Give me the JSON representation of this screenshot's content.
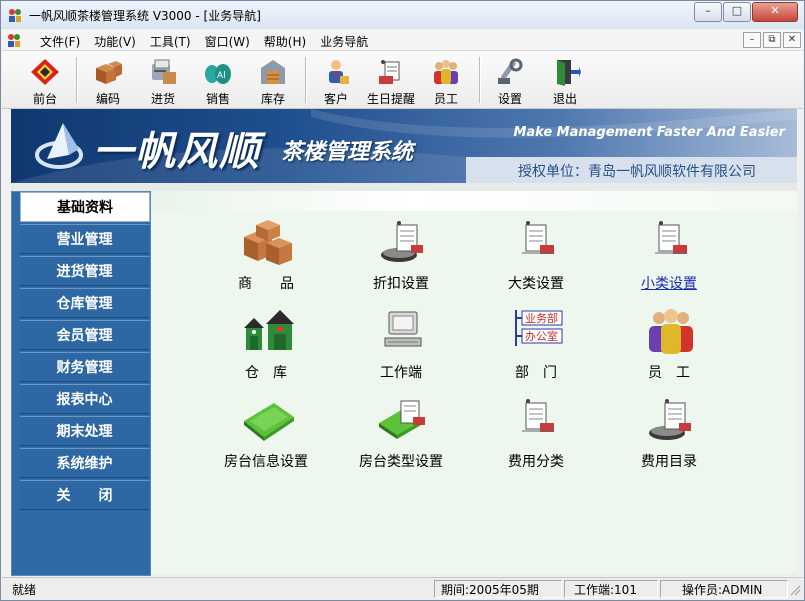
{
  "window": {
    "title": "一帆风顺茶楼管理系统 V3000 - [业务导航]"
  },
  "window_controls": {
    "minimize": "–",
    "maximize": "□",
    "close": "✕"
  },
  "menubar": {
    "items": [
      "文件(F)",
      "功能(V)",
      "工具(T)",
      "窗口(W)",
      "帮助(H)",
      "业务导航"
    ],
    "mdi_controls": [
      "–",
      "⧉",
      "✕"
    ]
  },
  "toolbar": {
    "buttons": [
      {
        "label": "前台",
        "icon": "front-desk-icon"
      },
      {
        "label": "编码",
        "icon": "coding-boxes-icon"
      },
      {
        "label": "进货",
        "icon": "purchase-icon"
      },
      {
        "label": "销售",
        "icon": "sales-icon"
      },
      {
        "label": "库存",
        "icon": "inventory-icon"
      },
      {
        "label": "客户",
        "icon": "customer-icon"
      },
      {
        "label": "生日提醒",
        "icon": "birthday-reminder-icon"
      },
      {
        "label": "员工",
        "icon": "employee-icon"
      },
      {
        "label": "设置",
        "icon": "settings-tools-icon"
      },
      {
        "label": "退出",
        "icon": "exit-door-icon"
      }
    ]
  },
  "banner": {
    "brand": "一帆风顺",
    "subtitle": "茶楼管理系统",
    "slogan": "Make Management Faster And Easier",
    "license": "授权单位：青岛一帆风顺软件有限公司"
  },
  "nav": {
    "items": [
      "基础资料",
      "营业管理",
      "进货管理",
      "仓库管理",
      "会员管理",
      "财务管理",
      "报表中心",
      "期末处理",
      "系统维护",
      "关　　闭"
    ],
    "active_index": 0
  },
  "grid": {
    "items": [
      {
        "label": "商　　品",
        "icon": "goods-boxes-icon"
      },
      {
        "label": "折扣设置",
        "icon": "discount-settings-icon"
      },
      {
        "label": "大类设置",
        "icon": "major-category-icon"
      },
      {
        "label": "小类设置",
        "icon": "minor-category-icon",
        "link": true
      },
      {
        "label": "仓　库",
        "icon": "warehouse-icon"
      },
      {
        "label": "工作端",
        "icon": "workstation-computer-icon"
      },
      {
        "label": "部　门",
        "icon": "department-icon"
      },
      {
        "label": "员　工",
        "icon": "staff-icon"
      },
      {
        "label": "房台信息设置",
        "icon": "room-info-icon"
      },
      {
        "label": "房台类型设置",
        "icon": "room-type-icon"
      },
      {
        "label": "费用分类",
        "icon": "expense-category-icon"
      },
      {
        "label": "费用目录",
        "icon": "expense-catalog-icon"
      }
    ],
    "department_tags": [
      "业务部",
      "办公室"
    ]
  },
  "statusbar": {
    "status": "就绪",
    "period": "期间:2005年05期",
    "workstation": "工作端:101",
    "operator": "操作员:ADMIN"
  },
  "colors": {
    "nav_bg": "#2e68a4",
    "banner_dark": "#0f3870",
    "content_bg": "#eef7ee",
    "link": "#1a2ab8"
  }
}
